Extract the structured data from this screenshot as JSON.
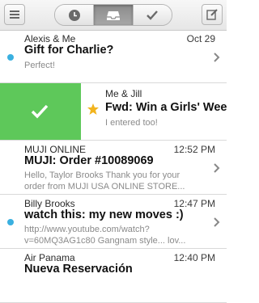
{
  "toolbar": {
    "menu_icon": "hamburger-icon",
    "tabs": [
      {
        "icon": "clock-icon"
      },
      {
        "icon": "inbox-tray-icon"
      },
      {
        "icon": "checkmark-icon"
      }
    ],
    "compose_icon": "compose-icon"
  },
  "messages": [
    {
      "sender": "Alexis & Me",
      "time": "Oct 29",
      "subject": "Gift for Charlie?",
      "preview": "Perfect!",
      "unread": true
    },
    {
      "sender": "Me & Jill",
      "time": "",
      "subject": "Fwd: Win a Girls' Wee",
      "preview": "I entered too!",
      "starred": true,
      "swiped": true
    },
    {
      "sender": "MUJI ONLINE",
      "time": "12:52 PM",
      "subject": "MUJI: Order #10089069",
      "preview": "Hello, Taylor Brooks Thank you for your order from MUJI USA ONLINE STORE..."
    },
    {
      "sender": "Billy Brooks",
      "time": "12:47 PM",
      "subject": "watch this: my new moves :)",
      "preview": "http://www.youtube.com/watch?v=60MQ3AG1c80 Gangnam style... lov...",
      "unread": true
    },
    {
      "sender": "Air Panama",
      "time": "12:40 PM",
      "subject": "Nueva Reservación",
      "preview": ""
    }
  ],
  "colors": {
    "swipe_green": "#5ec85a",
    "unread_dot": "#3ab0e0",
    "star": "#f2b41e"
  }
}
